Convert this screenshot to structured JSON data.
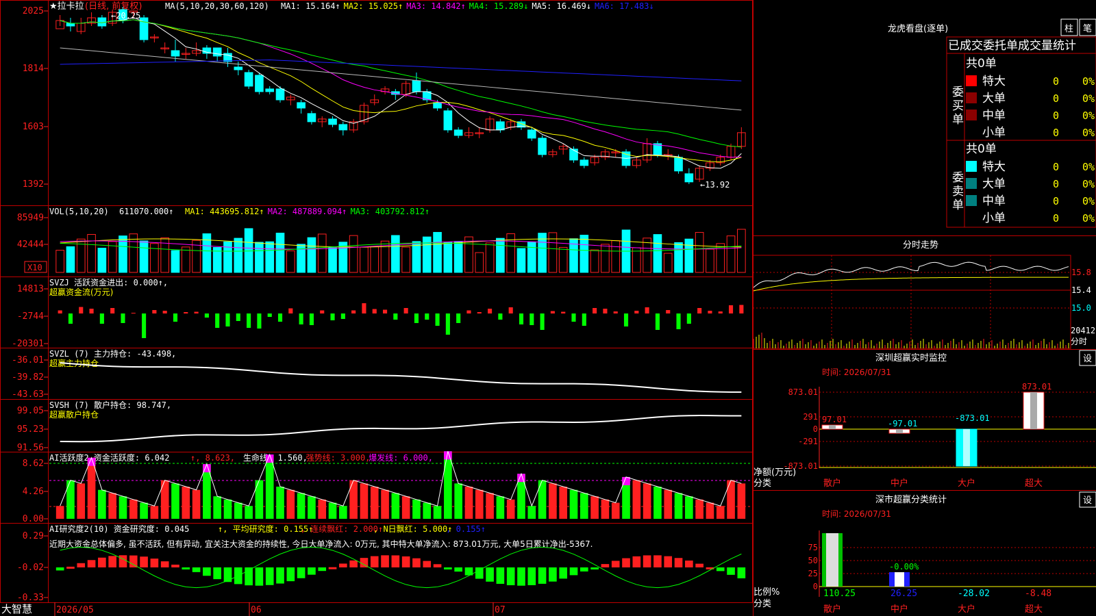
{
  "colors": {
    "up": "#ff2020",
    "down": "#00ffff",
    "grid": "#c00000",
    "text": "#ffffff",
    "yellow": "#ffff00",
    "magenta": "#ff00ff",
    "green": "#00ff00",
    "blue": "#2020ff",
    "white": "#ffffff",
    "orange": "#ff6600",
    "gray": "#bbbbbb",
    "darkred": "#8b0000",
    "teal": "#008080"
  },
  "price_panel": {
    "title": "★拉卡拉",
    "subtitle": "(日线, 前复权)",
    "ma_label": "MA(5,10,20,30,60,120)",
    "ma_values": [
      {
        "label": "MA1: 15.164↑",
        "color": "#ffffff"
      },
      {
        "label": "MA2: 15.025↑",
        "color": "#ffff00"
      },
      {
        "label": "MA3: 14.842↑",
        "color": "#ff00ff"
      },
      {
        "label": "MA4: 15.289↓",
        "color": "#00ff00"
      },
      {
        "label": "MA5: 16.469↓",
        "color": "#ffffff"
      },
      {
        "label": "MA6: 17.483↓",
        "color": "#2020ff"
      }
    ],
    "y_ticks": [
      "2025",
      "1814",
      "1603",
      "1392"
    ],
    "high_label": "←20.25",
    "low_label": "←13.92"
  },
  "vol_panel": {
    "label": "VOL(5,10,20)",
    "value": "611070.000↑",
    "ma_values": [
      {
        "label": "MA1: 443695.812↑",
        "color": "#ffff00"
      },
      {
        "label": "MA2: 487889.094↑",
        "color": "#ff00ff"
      },
      {
        "label": "MA3: 403792.812↑",
        "color": "#00ff00"
      }
    ],
    "y_ticks": [
      "85949",
      "42444"
    ],
    "unit": "X10"
  },
  "svzj_panel": {
    "label": "SVZJ  活跃资金进出: 0.000↑,",
    "sub": "超赢资金流(万元)",
    "y_ticks": [
      "14813",
      "-2744",
      "-20301"
    ]
  },
  "svzl_panel": {
    "label": "SVZL (7) 主力持仓: -43.498,",
    "sub": "超赢主力持仓",
    "y_ticks": [
      "-36.01",
      "-39.82",
      "-43.63"
    ]
  },
  "svsh_panel": {
    "label": "SVSH (7) 散户持仓: 98.747,",
    "sub": "超赢散户持仓",
    "y_ticks": [
      "99.05",
      "95.23",
      "91.56"
    ]
  },
  "ai_active_panel": {
    "label": "AI活跃度2 资金活跃度: 6.042",
    "values": [
      {
        "label": "↑, 8.623, ",
        "color": "#ff2020"
      },
      {
        "label": "生命线: 1.560, ",
        "color": "#ffffff"
      },
      {
        "label": "强势线: 3.000, ",
        "color": "#ff2020"
      },
      {
        "label": "爆发线: 6.000,",
        "color": "#ff00ff"
      }
    ],
    "y_ticks": [
      "8.62",
      "4.26",
      "0.00"
    ]
  },
  "ai_research_panel": {
    "label": "AI研究度2(10) 资金研究度: 0.045",
    "values": [
      {
        "label": "↑, 平均研究度: 0.155↑",
        "color": "#ffff00"
      },
      {
        "label": ", 连续飘红: 2.000↑",
        "color": "#ff2020"
      },
      {
        "label": ", N日飘红: 5.000↑",
        "color": "#ffff00"
      },
      {
        "label": ", 0.155↑",
        "color": "#2020ff"
      }
    ],
    "note": "近期大资金总体偏多, 虽不活跃, 但有异动, 宜关注大资金的持续性, 今日大单净流入: 0万元, 其中特大单净流入: 873.01万元, 大单5日累计净出-5367.",
    "y_ticks": [
      "0.29",
      "-0.02",
      "-0.33"
    ]
  },
  "x_axis": {
    "labels": [
      "2026/05",
      "06",
      "07"
    ]
  },
  "brand": "大智慧",
  "right_panel": {
    "lhb": {
      "title": "龙虎看盘(逐单)",
      "btn1": "柱",
      "btn2": "笔",
      "table_title": "已成交委托单成交量统计",
      "buy": {
        "side": "委买单",
        "total": "共0单",
        "rows": [
          {
            "name": "特大",
            "count": "0",
            "pct": "0%",
            "color": "#ff0000"
          },
          {
            "name": "大单",
            "count": "0",
            "pct": "0%",
            "color": "#8b0000"
          },
          {
            "name": "中单",
            "count": "0",
            "pct": "0%",
            "color": "#8b0000"
          },
          {
            "name": "小单",
            "count": "0",
            "pct": "0%",
            "color": ""
          }
        ]
      },
      "sell": {
        "side": "委卖单",
        "total": "共0单",
        "rows": [
          {
            "name": "特大",
            "count": "0",
            "pct": "0%",
            "color": "#00ffff"
          },
          {
            "name": "大单",
            "count": "0",
            "pct": "0%",
            "color": "#008080"
          },
          {
            "name": "中单",
            "count": "0",
            "pct": "0%",
            "color": "#008080"
          },
          {
            "name": "小单",
            "count": "0",
            "pct": "0%",
            "color": ""
          }
        ]
      }
    },
    "intraday": {
      "title": "分时走势",
      "y_ticks": [
        "15.8",
        "15.4",
        "15.0"
      ],
      "vol_label": "20412",
      "vol_unit": "分时"
    },
    "sz_monitor": {
      "title": "深圳超赢实时监控",
      "btn": "设",
      "time": "时间: 2026/07/31",
      "y_ticks": [
        "873.01",
        "291",
        "0",
        "-291",
        "-873.01"
      ],
      "ylabel1": "净额(万元)",
      "ylabel2": "分类",
      "categories": [
        "散户",
        "中户",
        "大户",
        "超大"
      ],
      "values": [
        97.01,
        -97.01,
        -873.01,
        873.01
      ],
      "value_labels": [
        "97.01",
        "-97.01",
        "-873.01",
        "873.01"
      ]
    },
    "sz_class": {
      "title": "深市超赢分类统计",
      "btn": "设",
      "time": "时间: 2026/07/31",
      "y_ticks": [
        "75",
        "50",
        "25",
        "0"
      ],
      "ylabel1": "比例%",
      "ylabel2": "分类",
      "categories": [
        "散户",
        "中户",
        "大户",
        "超大"
      ],
      "values": [
        110.25,
        26.25,
        -28.02,
        -8.48
      ],
      "value_labels": [
        "110.25",
        "26.25",
        "-28.02",
        "-8.48"
      ],
      "zero_label": "-0.00%"
    }
  },
  "chart_data": {
    "type": "candlestick",
    "title": "★拉卡拉",
    "x": [
      "2026/05",
      "06",
      "07"
    ],
    "ylim": [
      13.92,
      20.25
    ],
    "candles": [
      [
        19.6,
        19.9,
        19.7,
        20.1
      ],
      [
        19.8,
        19.7,
        19.5,
        20.0
      ],
      [
        19.5,
        19.8,
        19.4,
        20.0
      ],
      [
        19.8,
        20.0,
        19.7,
        20.2
      ],
      [
        20.0,
        19.7,
        19.6,
        20.1
      ],
      [
        19.8,
        20.2,
        19.7,
        20.3
      ],
      [
        20.3,
        19.9,
        19.8,
        20.4
      ],
      [
        20.2,
        20.25,
        20.0,
        20.25
      ],
      [
        20.0,
        19.2,
        19.1,
        20.1
      ],
      [
        19.3,
        19.3,
        19.1,
        19.4
      ],
      [
        18.9,
        18.9,
        18.7,
        19.1
      ],
      [
        18.8,
        18.6,
        18.4,
        19.2
      ],
      [
        18.7,
        18.7,
        18.5,
        18.9
      ],
      [
        18.7,
        18.8,
        18.6,
        19.1
      ],
      [
        18.9,
        18.7,
        18.5,
        19.0
      ],
      [
        18.9,
        18.6,
        18.4,
        18.9
      ],
      [
        18.7,
        18.4,
        18.2,
        18.9
      ],
      [
        18.2,
        18.1,
        17.9,
        18.4
      ],
      [
        18.0,
        17.5,
        17.4,
        18.1
      ],
      [
        17.9,
        17.3,
        17.2,
        18.0
      ],
      [
        17.4,
        17.3,
        17.2,
        17.5
      ],
      [
        17.4,
        17.0,
        16.9,
        17.5
      ],
      [
        17.0,
        17.1,
        16.8,
        17.2
      ],
      [
        16.9,
        16.7,
        16.5,
        17.0
      ],
      [
        16.5,
        16.2,
        16.1,
        16.6
      ],
      [
        16.2,
        16.3,
        16.0,
        16.4
      ],
      [
        16.3,
        16.1,
        16.0,
        16.4
      ],
      [
        16.1,
        15.9,
        15.7,
        16.2
      ],
      [
        15.9,
        16.2,
        15.8,
        16.3
      ],
      [
        16.2,
        16.8,
        16.1,
        16.9
      ],
      [
        16.9,
        17.0,
        16.8,
        17.2
      ],
      [
        17.3,
        17.4,
        17.2,
        17.5
      ],
      [
        17.3,
        17.2,
        17.0,
        17.4
      ],
      [
        17.2,
        17.6,
        17.1,
        17.7
      ],
      [
        17.7,
        17.3,
        17.2,
        18.0
      ],
      [
        17.3,
        17.0,
        16.9,
        17.4
      ],
      [
        16.9,
        16.7,
        16.6,
        17.0
      ],
      [
        16.6,
        15.9,
        15.8,
        16.7
      ],
      [
        15.9,
        15.7,
        15.6,
        16.0
      ],
      [
        15.7,
        15.8,
        15.6,
        16.0
      ],
      [
        15.8,
        15.8,
        15.6,
        16.0
      ],
      [
        15.9,
        16.3,
        15.8,
        16.4
      ],
      [
        16.2,
        15.9,
        15.8,
        16.3
      ],
      [
        16.0,
        16.2,
        15.9,
        16.3
      ],
      [
        16.2,
        16.0,
        15.9,
        16.3
      ],
      [
        15.9,
        15.6,
        15.5,
        16.0
      ],
      [
        15.6,
        15.0,
        14.9,
        15.7
      ],
      [
        15.0,
        15.1,
        14.9,
        15.2
      ],
      [
        15.2,
        15.3,
        15.0,
        15.4
      ],
      [
        15.2,
        14.8,
        14.7,
        15.3
      ],
      [
        14.8,
        14.6,
        14.5,
        14.9
      ],
      [
        14.7,
        14.9,
        14.6,
        15.0
      ],
      [
        14.9,
        15.1,
        14.8,
        15.2
      ],
      [
        15.1,
        15.1,
        14.9,
        15.2
      ],
      [
        15.1,
        14.6,
        14.5,
        15.2
      ],
      [
        14.6,
        14.8,
        14.5,
        14.9
      ],
      [
        14.8,
        15.4,
        14.7,
        15.6
      ],
      [
        15.4,
        15.0,
        14.9,
        15.5
      ],
      [
        15.0,
        15.0,
        14.8,
        15.2
      ],
      [
        14.9,
        14.4,
        14.3,
        15.0
      ],
      [
        14.3,
        14.0,
        13.92,
        14.5
      ],
      [
        14.1,
        14.5,
        14.0,
        14.6
      ],
      [
        14.5,
        14.7,
        14.4,
        14.8
      ],
      [
        14.7,
        14.9,
        14.6,
        15.0
      ],
      [
        14.9,
        15.3,
        14.8,
        15.4
      ],
      [
        15.3,
        15.8,
        15.2,
        16.0
      ]
    ]
  }
}
